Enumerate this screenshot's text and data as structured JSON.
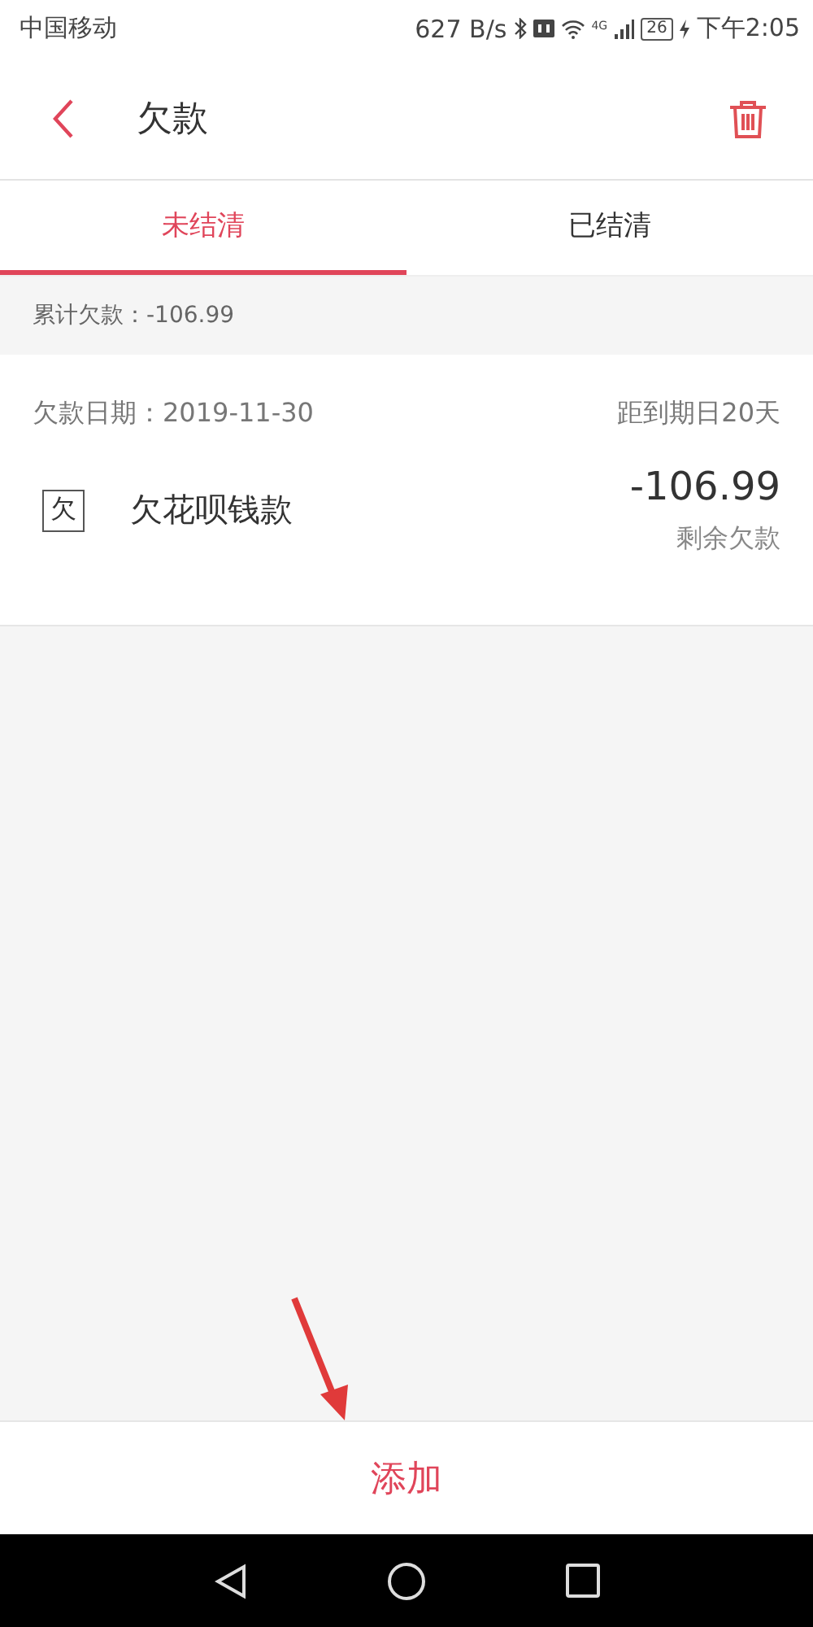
{
  "status_bar": {
    "carrier": "中国移动",
    "speed": "627 B/s",
    "network": "4G",
    "battery": "26",
    "time": "下午2:05"
  },
  "header": {
    "title": "欠款"
  },
  "tabs": [
    {
      "label": "未结清",
      "selected": true
    },
    {
      "label": "已结清",
      "selected": false
    }
  ],
  "summary": "累计欠款：-106.99",
  "debts": [
    {
      "date": "欠款日期：2019-11-30",
      "due": "距到期日20天",
      "icon_char": "欠",
      "name": "欠花呗钱款",
      "amount": "-106.99",
      "amount_label": "剩余欠款"
    }
  ],
  "add_button": "添加"
}
